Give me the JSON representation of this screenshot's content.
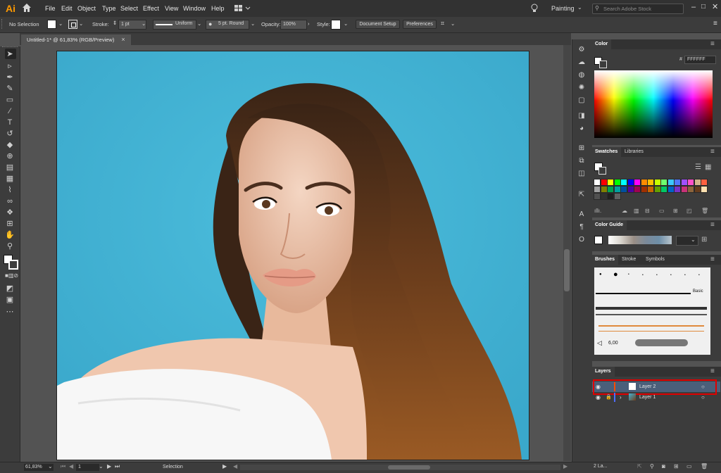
{
  "app": {
    "logo": "Ai",
    "workspace": "Painting",
    "search_placeholder": "Search Adobe Stock"
  },
  "menu": [
    "File",
    "Edit",
    "Object",
    "Type",
    "Select",
    "Effect",
    "View",
    "Window",
    "Help"
  ],
  "control": {
    "selection": "No Selection",
    "stroke_label": "Stroke:",
    "stroke_value": "1 pt",
    "profile": "Uniform",
    "brush": "5 pt. Round",
    "opacity_label": "Opacity:",
    "opacity_value": "100%",
    "style_label": "Style:",
    "doc_setup": "Document Setup",
    "preferences": "Preferences"
  },
  "document": {
    "tab_title": "Untitled-1* @ 61,83% (RGB/Preview)",
    "close": "×"
  },
  "color_panel": {
    "title": "Color",
    "hex_symbol": "#",
    "hex_value": "FFFFFF"
  },
  "swatches_panel": {
    "tabs": [
      "Swatches",
      "Libraries"
    ]
  },
  "color_guide_panel": {
    "title": "Color Guide"
  },
  "brushes_panel": {
    "tabs": [
      "Brushes",
      "Stroke",
      "Symbols"
    ],
    "basic_label": "Basic",
    "size_value": "6,00"
  },
  "layers_panel": {
    "title": "Layers",
    "layers": [
      {
        "name": "Layer 2",
        "color": "#ff4b00",
        "selected": true
      },
      {
        "name": "Layer 1",
        "color": "#4f6cff",
        "selected": false
      }
    ],
    "count": "2 La..."
  },
  "status": {
    "zoom": "61,83%",
    "artboard": "1",
    "tool": "Selection"
  },
  "colors": {
    "accent": "#ff9a00",
    "highlight": "#e00000",
    "canvas_bg": "#45b4d4"
  },
  "swatch_colors": [
    "#ffffff",
    "#ff0000",
    "#ffff00",
    "#00ff00",
    "#00ffff",
    "#0000ff",
    "#ff00ff",
    "#ff8c00",
    "#ffc000",
    "#c8ff00",
    "#6eff6e",
    "#3cc8ff",
    "#5078ff",
    "#a050ff",
    "#ff50c8",
    "#d2b48c",
    "#ff6040",
    "#a0a0a0",
    "#808000",
    "#00a050",
    "#00a0a0",
    "#0050a0",
    "#5000a0",
    "#a00050",
    "#a03000",
    "#c86400",
    "#64a000",
    "#00c864",
    "#0064c8",
    "#7832c8",
    "#c83278",
    "#8c643c",
    "#643c1e",
    "#ffe0b0",
    "#505050",
    "#303030",
    "#202020",
    "#606060"
  ]
}
